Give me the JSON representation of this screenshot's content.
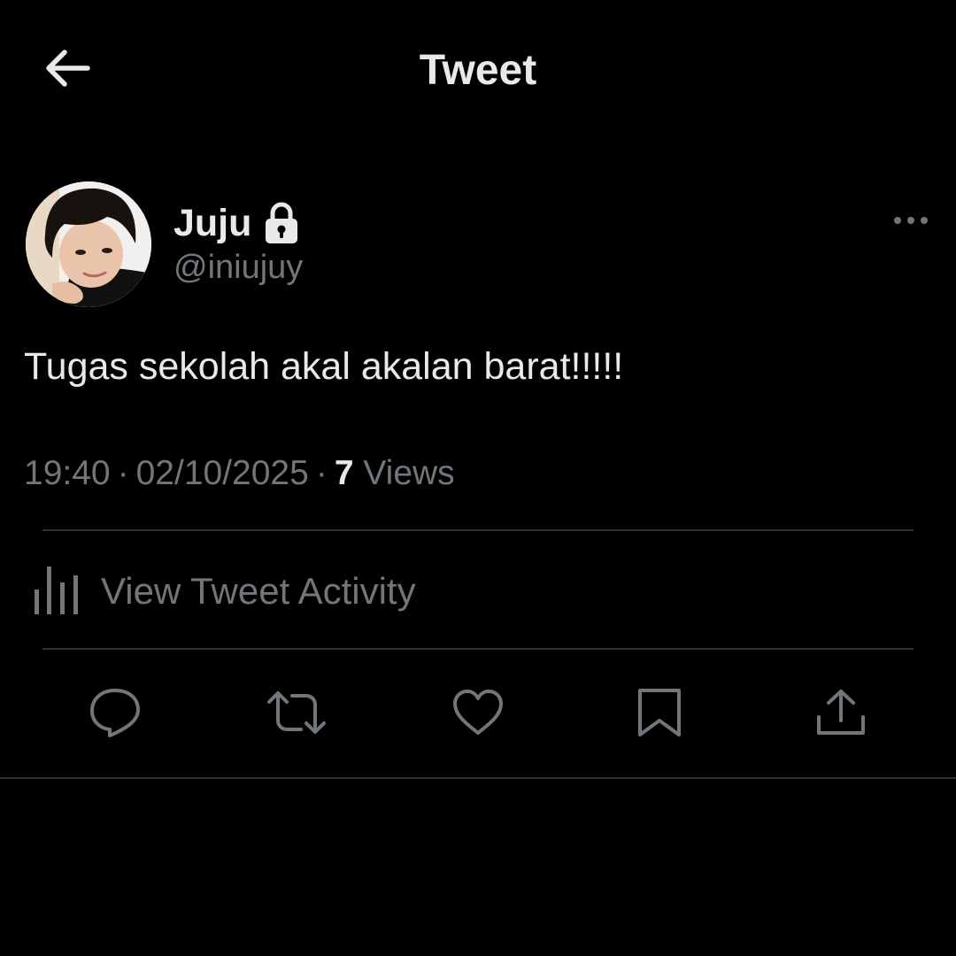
{
  "header": {
    "title": "Tweet",
    "back_icon": "arrow-left-icon"
  },
  "author": {
    "display_name": "Juju",
    "handle": "@iniujuy",
    "protected_icon": "lock-icon",
    "avatar": "profile-photo"
  },
  "tweet": {
    "text": "Tugas sekolah akal akalan barat!!!!!",
    "time": "19:40",
    "date": "02/10/2025",
    "views_count": "7",
    "views_label": "Views"
  },
  "activity": {
    "label": "View Tweet Activity",
    "icon": "analytics-bars-icon"
  },
  "actions": {
    "reply_icon": "reply-icon",
    "retweet_icon": "retweet-icon",
    "like_icon": "heart-icon",
    "bookmark_icon": "bookmark-icon",
    "share_icon": "share-icon"
  },
  "colors": {
    "background": "#000000",
    "primary_text": "#e7e9ea",
    "secondary_text": "#71767b",
    "divider": "#2f3336"
  }
}
